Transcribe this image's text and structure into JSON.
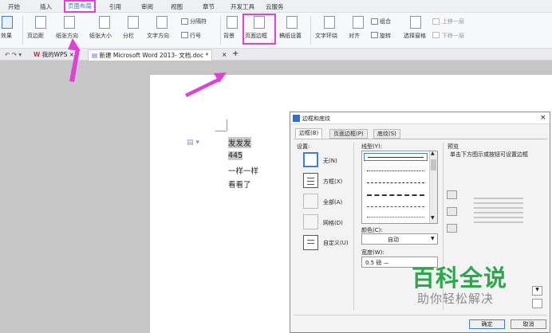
{
  "menu": {
    "tabs": [
      "开始",
      "插入",
      "页面布局",
      "引用",
      "审阅",
      "视图",
      "章节",
      "开发工具",
      "云服务"
    ],
    "active": "页面布局"
  },
  "ribbon": {
    "effects": "效果",
    "margins": "页边距",
    "orientation": "纸张方向",
    "size": "纸张大小",
    "columns": "分栏",
    "text_direction": "文字方向",
    "separator": "分隔符",
    "line_numbers": "行号",
    "background": "背景",
    "page_border": "页面边框",
    "draft_settings": "稿纸设置",
    "text_wrap": "文字环绕",
    "align": "对齐",
    "group": "组合",
    "rotate": "旋转",
    "selection_pane": "选择窗格",
    "bring_forward": "上移一层",
    "send_backward": "下移一层"
  },
  "tabs": {
    "wps_tab": "我的WPS",
    "doc_tab": "新建 Microsoft Word 2013- 文档.doc *",
    "close": "×",
    "new": "+"
  },
  "document": {
    "lines": [
      "发发发",
      "445",
      "一样一样",
      "看看了"
    ]
  },
  "dialog": {
    "title": "边框和底纹",
    "close": "×",
    "tabs": [
      "边框(B)",
      "页面边框(P)",
      "底纹(S)"
    ],
    "settings_label": "设置:",
    "settings": [
      {
        "label": "无(N)",
        "enabled": true
      },
      {
        "label": "方框(X)",
        "enabled": true
      },
      {
        "label": "全部(A)",
        "enabled": false
      },
      {
        "label": "网格(D)",
        "enabled": false
      },
      {
        "label": "自定义(U)",
        "enabled": true
      }
    ],
    "style_label": "线型(Y):",
    "color_label": "颜色(C):",
    "color_value": "自动",
    "width_label": "宽度(W):",
    "width_value": "0.5 磅 —",
    "preview_label": "预览",
    "preview_hint": "单击下方图示或按钮可设置边框",
    "ok": "确定",
    "cancel": "取消"
  },
  "watermark": {
    "line1": "百科全说",
    "line2": "助你轻松解决"
  },
  "colors": {
    "highlight": "#e040d8",
    "accent": "#2b6fd1",
    "watermark": "#2aa84a"
  }
}
